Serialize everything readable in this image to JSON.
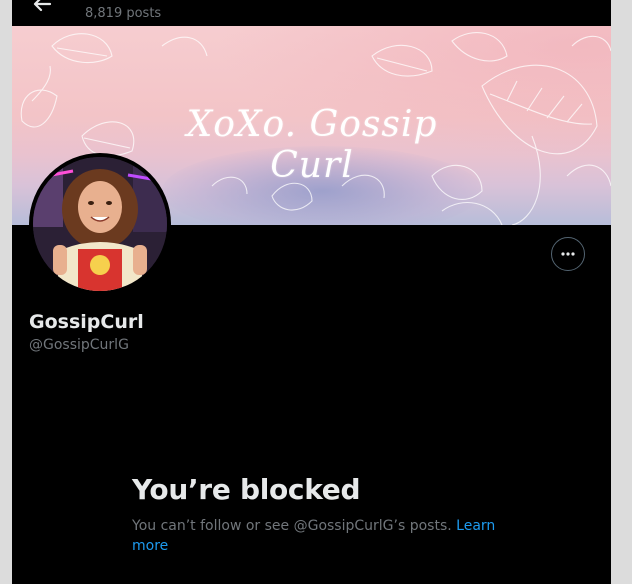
{
  "header": {
    "post_count": "8,819 posts"
  },
  "banner": {
    "title": "XoXo. Gossip Curl"
  },
  "profile": {
    "display_name": "GossipCurl",
    "handle": "@GossipCurlG",
    "more_icon": "more-horizontal-icon",
    "back_icon": "arrow-left-icon"
  },
  "blocked": {
    "title": "You’re blocked",
    "message": "You can’t follow or see @GossipCurlG’s posts.",
    "learn_more": "Learn more"
  },
  "colors": {
    "background": "#000000",
    "primary_text": "#e7e9ea",
    "secondary_text": "#71767b",
    "link": "#1d9bf0",
    "border": "#536471"
  }
}
